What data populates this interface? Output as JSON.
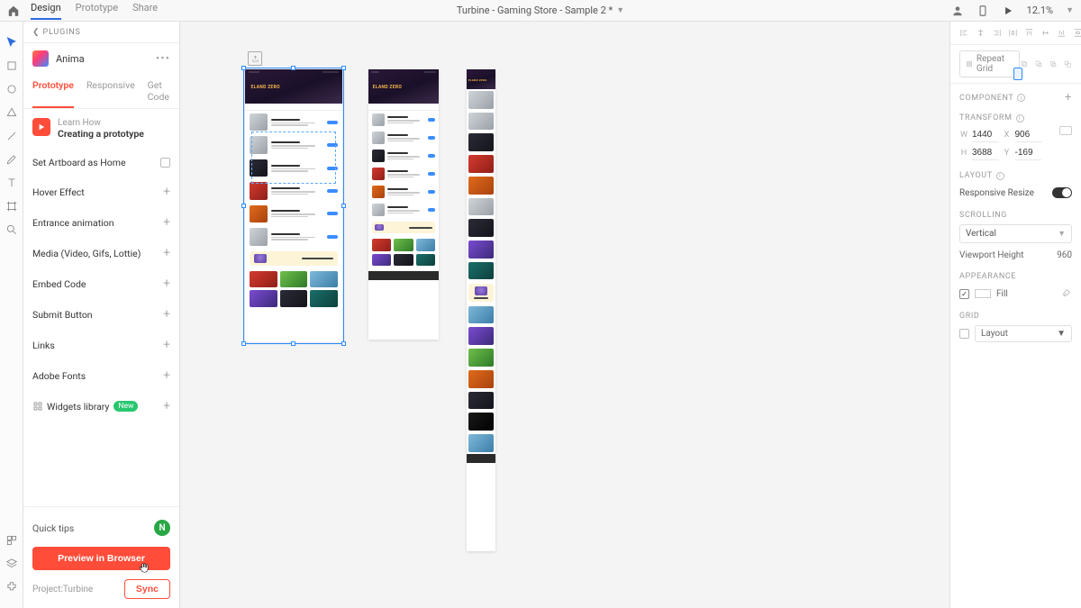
{
  "top": {
    "tabs": [
      "Design",
      "Prototype",
      "Share"
    ],
    "active_tab": 0,
    "doc_title": "Turbine - Gaming Store - Sample 2 *",
    "zoom": "12.1%"
  },
  "left": {
    "crumb": "PLUGINS",
    "plugin_name": "Anima",
    "subtabs": [
      "Prototype",
      "Responsive",
      "Get Code"
    ],
    "active_subtab": 0,
    "learn_sub": "Learn How",
    "learn_title": "Creating a prototype",
    "options": [
      {
        "label": "Set Artboard as Home",
        "kind": "check"
      },
      {
        "label": "Hover Effect",
        "kind": "plus"
      },
      {
        "label": "Entrance animation",
        "kind": "plus"
      },
      {
        "label": "Media (Video, Gifs, Lottie)",
        "kind": "plus"
      },
      {
        "label": "Embed Code",
        "kind": "plus"
      },
      {
        "label": "Submit Button",
        "kind": "plus"
      },
      {
        "label": "Links",
        "kind": "plus"
      },
      {
        "label": "Adobe Fonts",
        "kind": "plus"
      },
      {
        "label": "Widgets library",
        "kind": "plus",
        "badge": "New"
      }
    ],
    "quick_tips": "Quick tips",
    "avatar_initial": "N",
    "preview": "Preview in Browser",
    "project_label": "Project:Turbine",
    "sync": "Sync"
  },
  "canvas": {
    "artboards": [
      {
        "title": "ELAND ZERO"
      },
      {
        "title": "ELAND ZERO"
      },
      {
        "title": "ELAND ZERO"
      }
    ]
  },
  "right": {
    "repeat": "Repeat Grid",
    "sections": {
      "component": "COMPONENT",
      "transform": "TRANSFORM",
      "layout": "LAYOUT",
      "scrolling": "SCROLLING",
      "appearance": "APPEARANCE",
      "grid": "GRID"
    },
    "transform": {
      "W": "1440",
      "X": "906",
      "H": "3688",
      "Y": "-169"
    },
    "responsive_label": "Responsive Resize",
    "responsive_on": true,
    "scroll_value": "Vertical",
    "viewport_label": "Viewport Height",
    "viewport_value": "960",
    "fill_label": "Fill",
    "grid_value": "Layout"
  }
}
